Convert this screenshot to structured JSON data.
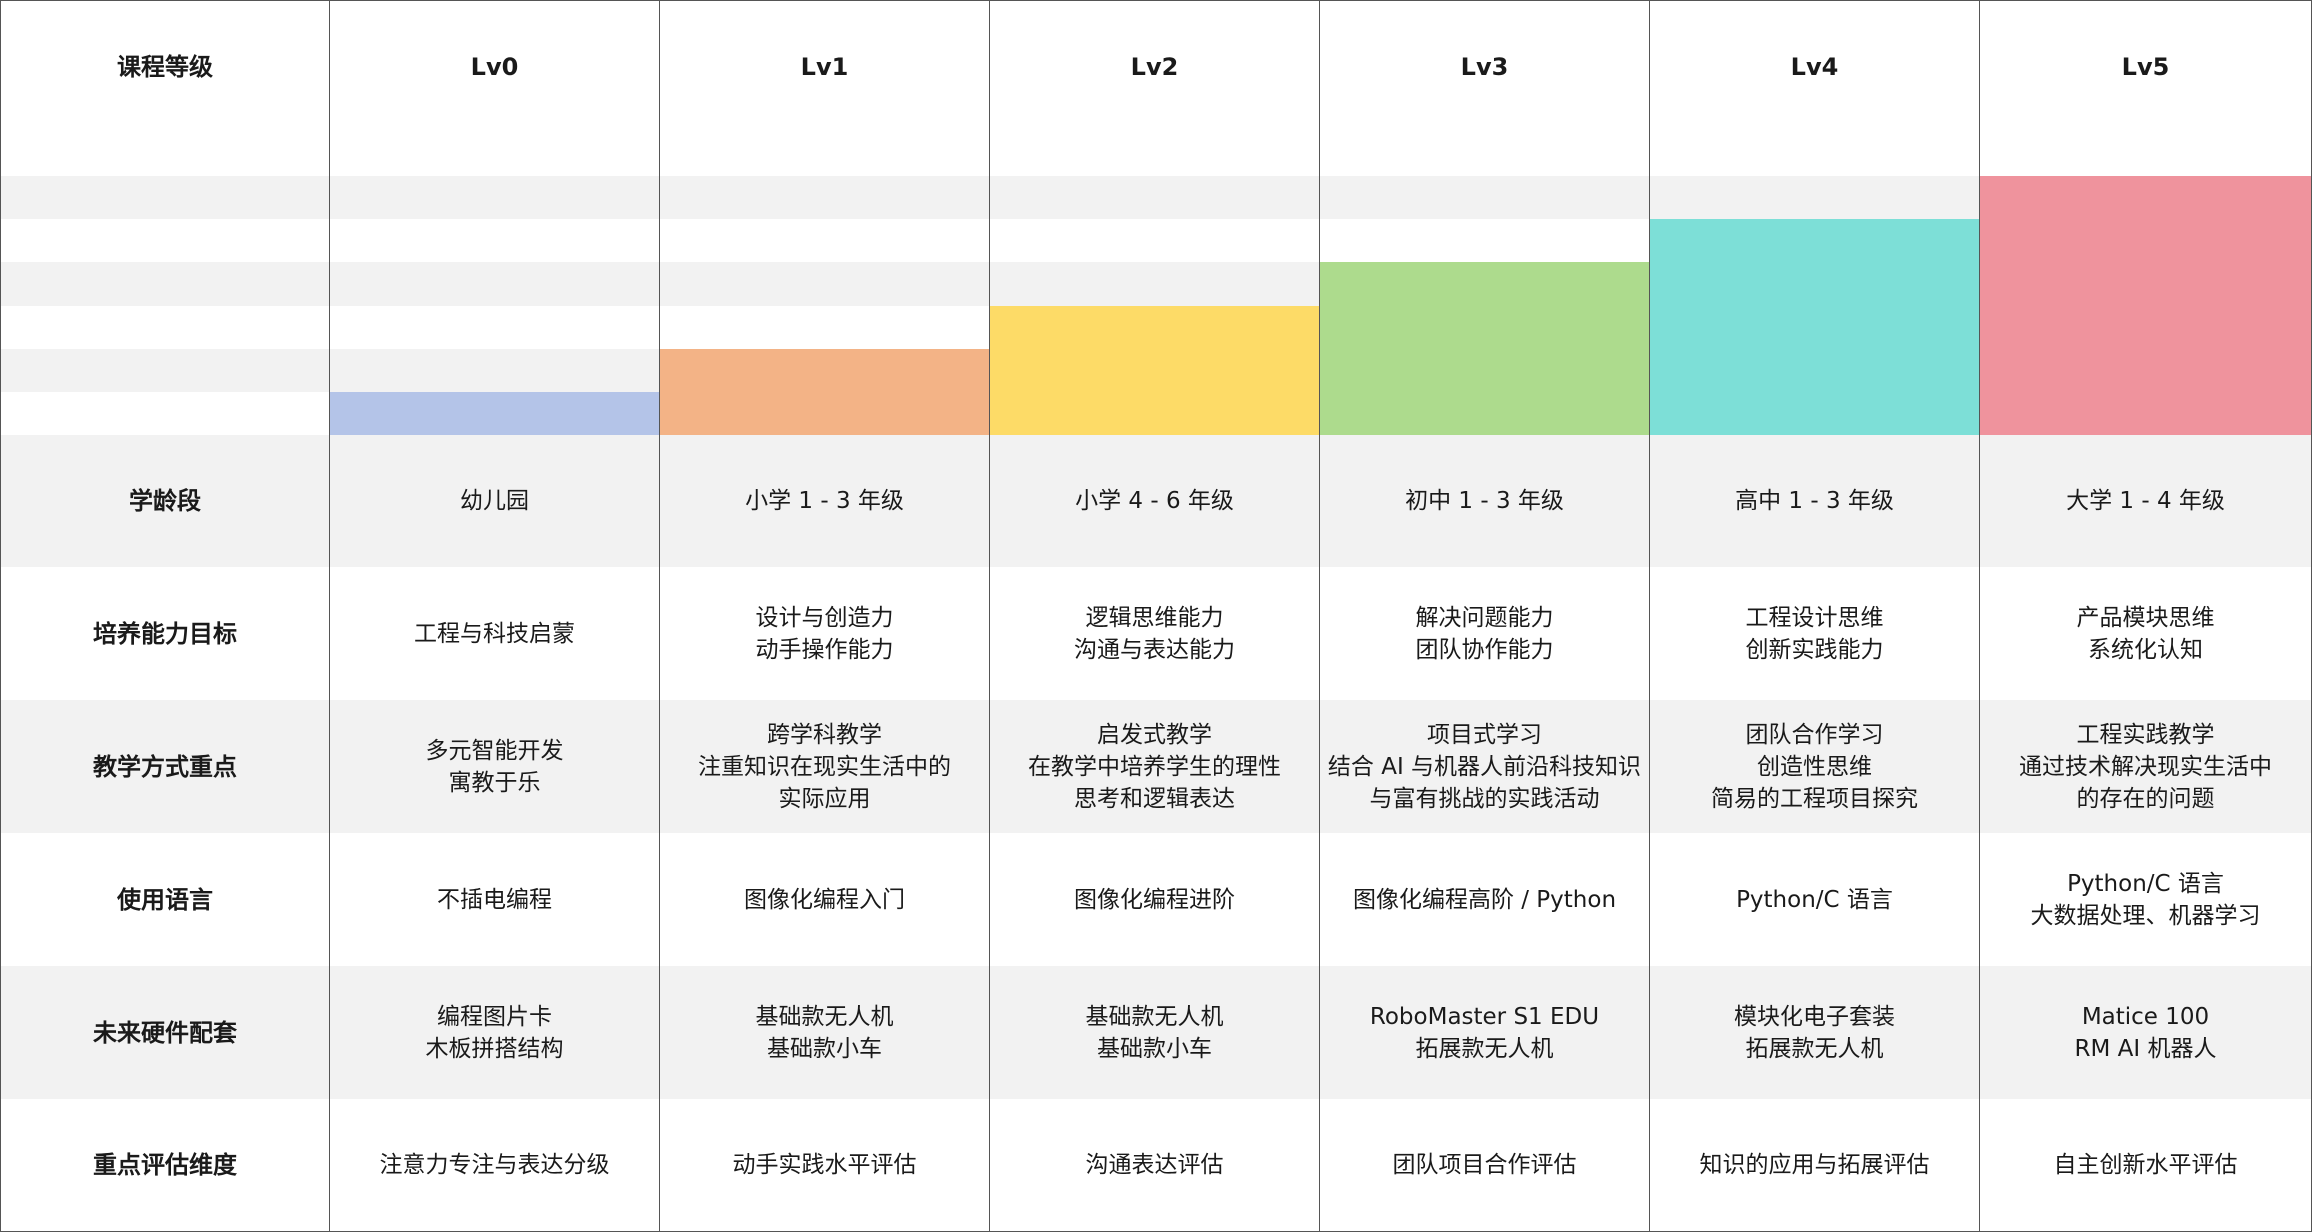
{
  "header": {
    "label": "课程等级",
    "levels": [
      "Lv0",
      "Lv1",
      "Lv2",
      "Lv3",
      "Lv4",
      "Lv5"
    ]
  },
  "level_bars": {
    "steps_total": 6,
    "levels": [
      {
        "level": "Lv0",
        "steps": 1,
        "color": "#b4c4e8"
      },
      {
        "level": "Lv1",
        "steps": 2,
        "color": "#f3b386"
      },
      {
        "level": "Lv2",
        "steps": 3,
        "color": "#fddb67"
      },
      {
        "level": "Lv3",
        "steps": 4,
        "color": "#addb8d"
      },
      {
        "level": "Lv4",
        "steps": 5,
        "color": "#7ddfd7"
      },
      {
        "level": "Lv5",
        "steps": 6,
        "color": "#ef939d"
      }
    ]
  },
  "rows": [
    {
      "label": "学龄段",
      "cells": [
        [
          "幼儿园"
        ],
        [
          "小学 1 - 3 年级"
        ],
        [
          "小学 4 - 6 年级"
        ],
        [
          "初中 1 - 3 年级"
        ],
        [
          "高中 1 - 3 年级"
        ],
        [
          "大学 1 - 4 年级"
        ]
      ]
    },
    {
      "label": "培养能力目标",
      "cells": [
        [
          "工程与科技启蒙"
        ],
        [
          "设计与创造力",
          "动手操作能力"
        ],
        [
          "逻辑思维能力",
          "沟通与表达能力"
        ],
        [
          "解决问题能力",
          "团队协作能力"
        ],
        [
          "工程设计思维",
          "创新实践能力"
        ],
        [
          "产品模块思维",
          "系统化认知"
        ]
      ]
    },
    {
      "label": "教学方式重点",
      "cells": [
        [
          "多元智能开发",
          "寓教于乐"
        ],
        [
          "跨学科教学",
          "注重知识在现实生活中的",
          "实际应用"
        ],
        [
          "启发式教学",
          "在教学中培养学生的理性",
          "思考和逻辑表达"
        ],
        [
          "项目式学习",
          "结合 AI 与机器人前沿科技知识",
          "与富有挑战的实践活动"
        ],
        [
          "团队合作学习",
          "创造性思维",
          "简易的工程项目探究"
        ],
        [
          "工程实践教学",
          "通过技术解决现实生活中",
          "的存在的问题"
        ]
      ]
    },
    {
      "label": "使用语言",
      "cells": [
        [
          "不插电编程"
        ],
        [
          "图像化编程入门"
        ],
        [
          "图像化编程进阶"
        ],
        [
          "图像化编程高阶 / Python"
        ],
        [
          "Python/C 语言"
        ],
        [
          "Python/C 语言",
          "大数据处理、机器学习"
        ]
      ]
    },
    {
      "label": "未来硬件配套",
      "cells": [
        [
          "编程图片卡",
          "木板拼搭结构"
        ],
        [
          "基础款无人机",
          "基础款小车"
        ],
        [
          "基础款无人机",
          "基础款小车"
        ],
        [
          "RoboMaster S1 EDU",
          "拓展款无人机"
        ],
        [
          "模块化电子套装",
          "拓展款无人机"
        ],
        [
          "Matice 100",
          "RM AI 机器人"
        ]
      ]
    },
    {
      "label": "重点评估维度",
      "cells": [
        [
          "注意力专注与表达分级"
        ],
        [
          "动手实践水平评估"
        ],
        [
          "沟通表达评估"
        ],
        [
          "团队项目合作评估"
        ],
        [
          "知识的应用与拓展评估"
        ],
        [
          "自主创新水平评估"
        ]
      ]
    }
  ]
}
